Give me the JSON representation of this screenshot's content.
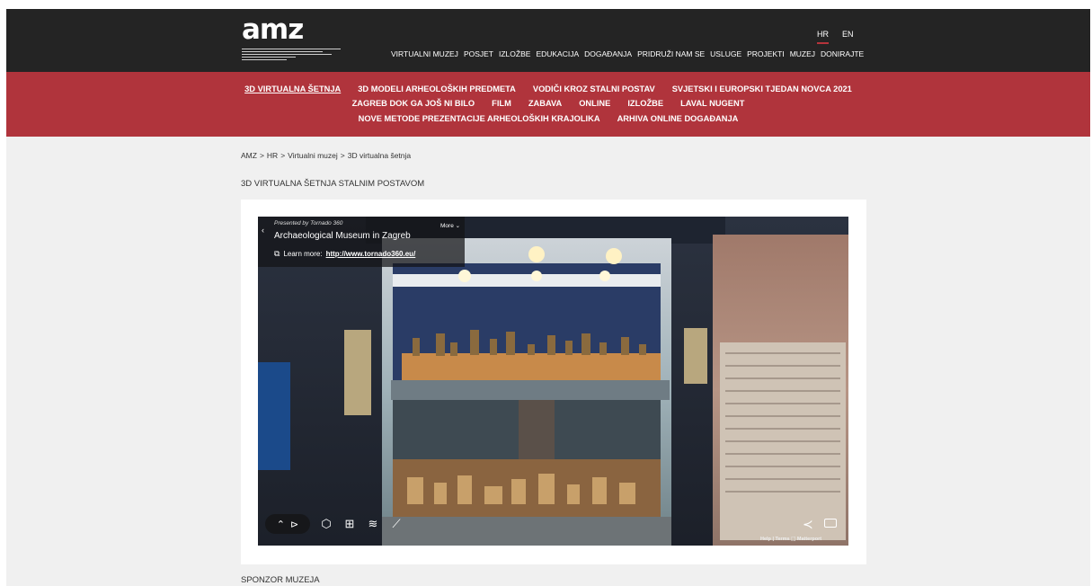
{
  "header": {
    "logo": "amz",
    "lang": [
      "HR",
      "EN"
    ],
    "nav": [
      "VIRTUALNI MUZEJ",
      "POSJET",
      "IZLOŽBE",
      "EDUKACIJA",
      "DOGAĐANJA",
      "PRIDRUŽI NAM SE",
      "USLUGE",
      "PROJEKTI",
      "MUZEJ",
      "DONIRAJTE"
    ]
  },
  "subnav": {
    "row1": [
      "3D VIRTUALNA ŠETNJA",
      "3D MODELI ARHEOLOŠKIH PREDMETA",
      "VODIČI KROZ STALNI POSTAV",
      "SVJETSKI I EUROPSKI TJEDAN NOVCA 2021"
    ],
    "row2": [
      "ZAGREB DOK GA JOŠ NI BILO",
      "FILM",
      "ZABAVA",
      "ONLINE",
      "IZLOŽBE",
      "LAVAL NUGENT"
    ],
    "row3": [
      "NOVE METODE PREZENTACIJE ARHEOLOŠKIH KRAJOLIKA",
      "ARHIVA ONLINE DOGAĐANJA"
    ]
  },
  "breadcrumb": [
    "AMZ",
    ">",
    "HR",
    ">",
    "Virtualni muzej",
    ">",
    "3D virtualna šetnja"
  ],
  "page_title": "3D VIRTUALNA ŠETNJA STALNIM POSTAVOM",
  "viewer": {
    "presented_by": "Presented by Tornado 360",
    "more": "More ⌄",
    "venue": "Archaeological Museum in Zagreb",
    "learn_label": "Learn more:",
    "learn_link": "http://www.tornado360.eu/",
    "footer": "Help  |  Terms  ⬚ Matterport",
    "icons": [
      "chevron-up-icon",
      "play-icon",
      "dollhouse-icon",
      "floorplan-icon",
      "floors-icon",
      "measure-icon",
      "share-icon",
      "vr-icon"
    ]
  },
  "sponsor": "SPONZOR MUZEJA"
}
